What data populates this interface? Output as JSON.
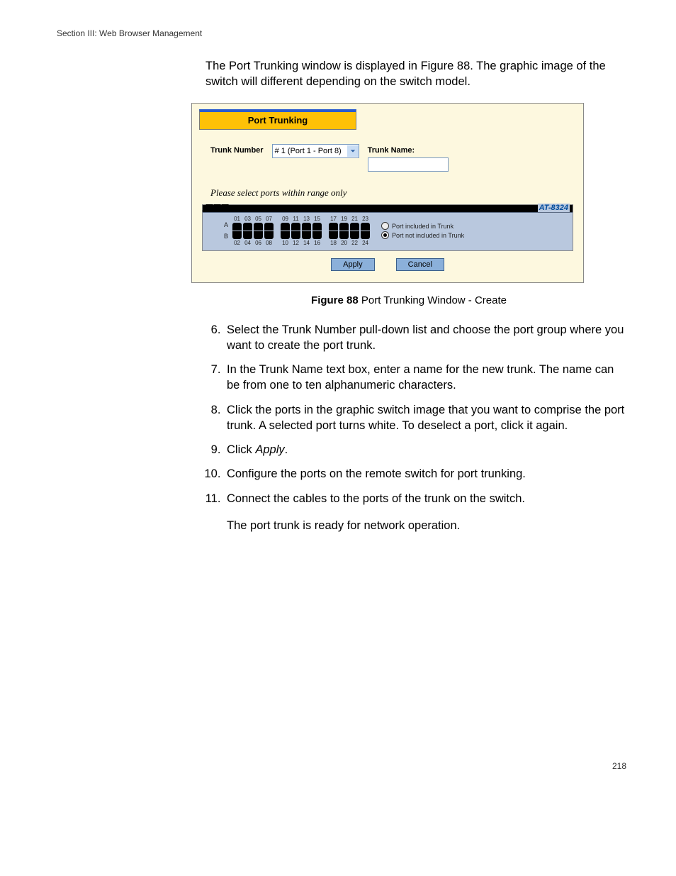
{
  "header": {
    "section": "Section III:  Web Browser Management"
  },
  "intro": "The Port Trunking window is displayed in Figure 88. The graphic image of the switch will different depending on the switch model.",
  "window": {
    "title": "Port Trunking",
    "trunk_number_label": "Trunk Number",
    "trunk_number_value": "# 1 (Port 1 - Port 8)",
    "trunk_name_label": "Trunk Name:",
    "trunk_name_value": "",
    "hint": "Please select ports within range only",
    "model": "AT-8324",
    "row_a": "A",
    "row_b": "B",
    "top_numbers": [
      [
        "01",
        "03",
        "05",
        "07"
      ],
      [
        "09",
        "11",
        "13",
        "15"
      ],
      [
        "17",
        "19",
        "21",
        "23"
      ]
    ],
    "bottom_numbers": [
      [
        "02",
        "04",
        "06",
        "08"
      ],
      [
        "10",
        "12",
        "14",
        "16"
      ],
      [
        "18",
        "20",
        "22",
        "24"
      ]
    ],
    "legend_included": "Port included in Trunk",
    "legend_not_included": "Port not included in Trunk",
    "apply": "Apply",
    "cancel": "Cancel"
  },
  "caption": {
    "label": "Figure 88",
    "text": "  Port Trunking Window - Create"
  },
  "steps": {
    "s6": "Select the Trunk Number pull-down list and choose the port group where you want to create the port trunk.",
    "s7": "In the Trunk Name text box, enter a name for the new trunk. The name can be from one to ten alphanumeric characters.",
    "s8": "Click the ports in the graphic switch image that you want to comprise the port trunk. A selected port turns white. To deselect a port, click it again.",
    "s9_pre": "Click ",
    "s9_em": "Apply",
    "s9_post": ".",
    "s10": "Configure the ports on the remote switch for port trunking.",
    "s11": "Connect the cables to the ports of the trunk on the switch."
  },
  "closing": "The port trunk is ready for network operation.",
  "page": "218"
}
